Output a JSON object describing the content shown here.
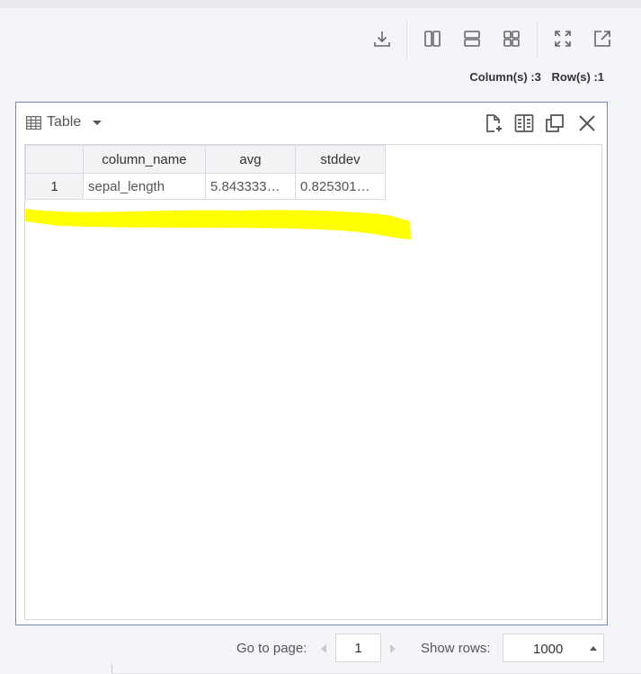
{
  "toolbar": {
    "buttons": [
      {
        "name": "download-button",
        "icon": "download-icon"
      },
      {
        "name": "split-vertical-button",
        "icon": "columns-icon"
      },
      {
        "name": "split-horizontal-button",
        "icon": "rows-icon"
      },
      {
        "name": "grid-layout-button",
        "icon": "grid-icon"
      },
      {
        "name": "fullscreen-button",
        "icon": "expand-icon"
      },
      {
        "name": "open-external-button",
        "icon": "external-link-icon"
      }
    ]
  },
  "counts": {
    "columns": "Column(s) :3",
    "rows": "Row(s) :1"
  },
  "panel": {
    "viz_label": "Table",
    "viz_icon": "table-icon",
    "actions": [
      "add-file-icon",
      "settings-list-icon",
      "copy-icon",
      "close-icon"
    ]
  },
  "table": {
    "headers": [
      "",
      "column_name",
      "avg",
      "stddev"
    ],
    "rows": [
      {
        "index": "1",
        "cells": [
          "sepal_length",
          "5.843333…",
          "0.825301…"
        ]
      }
    ]
  },
  "footer": {
    "goto_label": "Go to page:",
    "page_value": "1",
    "rows_label": "Show rows:",
    "rows_value": "1000"
  },
  "colors": {
    "accent_border": "#7b83c3",
    "highlight": "#ffff00"
  }
}
